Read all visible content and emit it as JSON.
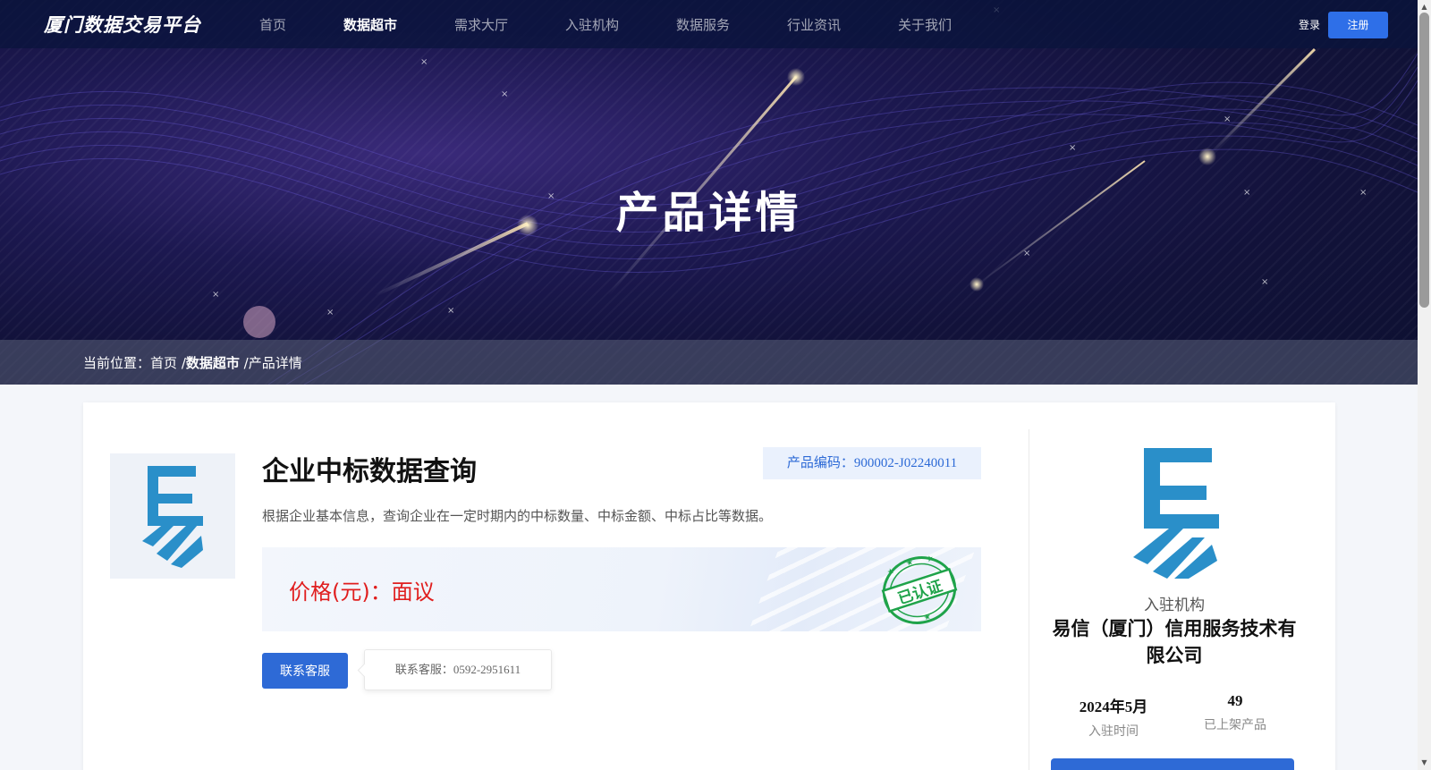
{
  "navbar": {
    "logo": "厦门数据交易平台",
    "items": [
      "首页",
      "数据超市",
      "需求大厅",
      "入驻机构",
      "数据服务",
      "行业资讯",
      "关于我们"
    ],
    "active_index": 1,
    "login": "登录",
    "register": "注册"
  },
  "hero": {
    "title": "产品详情"
  },
  "breadcrumb": {
    "prefix": "当前位置：",
    "home": "首页",
    "sep": "/",
    "section": "数据超市",
    "current": "产品详情"
  },
  "product": {
    "title": "企业中标数据查询",
    "code": "产品编码：900002-J02240011",
    "description": "根据企业基本信息，查询企业在一定时期内的中标数量、中标金额、中标占比等数据。",
    "price": "价格(元)：面议",
    "seal_text": "已认证",
    "contact_button": "联系客服",
    "contact_tip": "联系客服：0592-2951611"
  },
  "institution": {
    "label": "入驻机构",
    "name": "易信（厦门）信用服务技术有限公司",
    "join_time_value": "2024年5月",
    "join_time_label": "入驻时间",
    "products_value": "49",
    "products_label": "已上架产品"
  },
  "colors": {
    "accent": "#2e6ad6",
    "price": "#e01e1e",
    "seal": "#1fa34a",
    "logo_blue": "#2a8fc9"
  }
}
